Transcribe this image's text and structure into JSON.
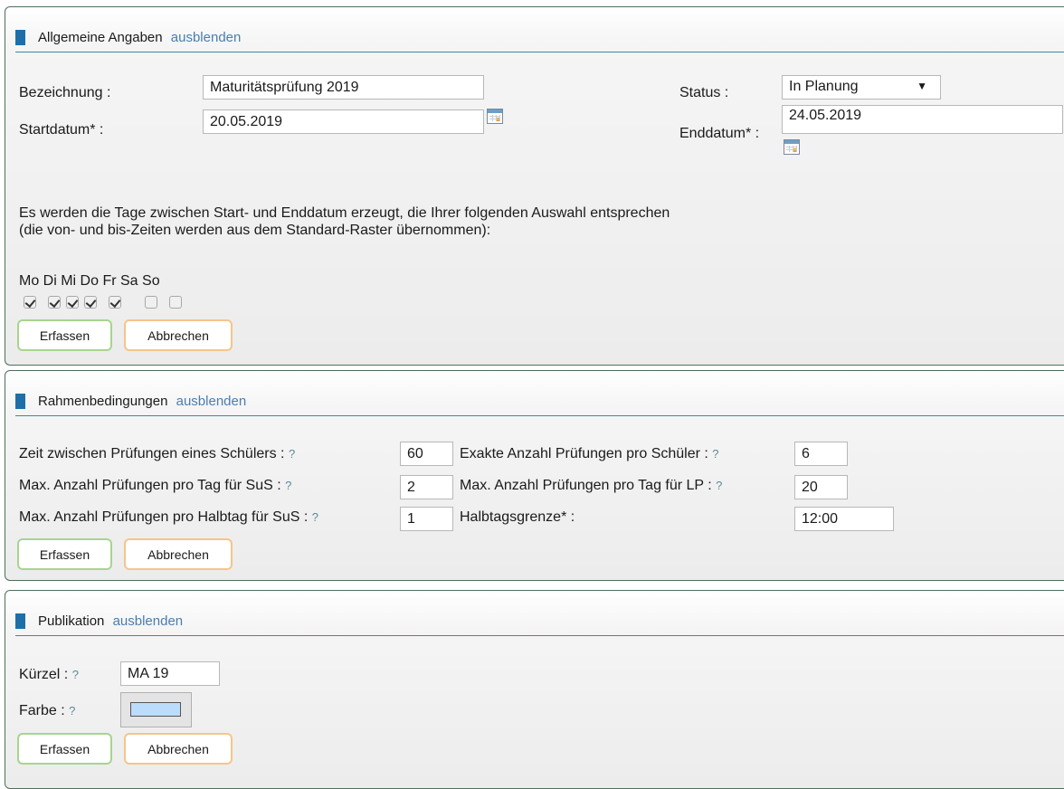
{
  "panel_general": {
    "title": "Allgemeine Angaben",
    "toggle": "ausblenden",
    "label_bezeichnung": "Bezeichnung :",
    "value_bezeichnung": "Maturitätsprüfung 2019",
    "label_startdatum": "Startdatum* :",
    "value_startdatum": "20.05.2019",
    "label_status": "Status :",
    "value_status": "In Planung",
    "label_enddatum": "Enddatum* :",
    "value_enddatum": "24.05.2019",
    "info_text": "Es werden die Tage zwischen Start- und Enddatum erzeugt, die Ihrer folgenden Auswahl entsprechen (die von- und bis-Zeiten werden aus dem Standard-Raster übernommen):",
    "days_header": "Mo Di Mi Do Fr Sa So",
    "days": [
      {
        "name": "Mo",
        "checked": true
      },
      {
        "name": "Di",
        "checked": true
      },
      {
        "name": "Mi",
        "checked": true
      },
      {
        "name": "Do",
        "checked": true
      },
      {
        "name": "Fr",
        "checked": true
      },
      {
        "name": "Sa",
        "checked": false
      },
      {
        "name": "So",
        "checked": false
      }
    ],
    "submit": "Erfassen",
    "cancel": "Abbrechen"
  },
  "panel_rahmen": {
    "title": "Rahmenbedingungen",
    "toggle": "ausblenden",
    "help": "?",
    "label_zeit": "Zeit zwischen Prüfungen eines Schülers :",
    "value_zeit": "60",
    "label_exakt": "Exakte Anzahl Prüfungen pro Schüler :",
    "value_exakt": "6",
    "label_max_tag_sus": "Max. Anzahl Prüfungen pro Tag für SuS :",
    "value_max_tag_sus": "2",
    "label_max_tag_lp": "Max. Anzahl Prüfungen pro Tag für LP :",
    "value_max_tag_lp": "20",
    "label_max_halbtag_sus": "Max. Anzahl Prüfungen pro Halbtag für SuS :",
    "value_max_halbtag_sus": "1",
    "label_halbtagsgrenze": "Halbtagsgrenze* :",
    "value_halbtagsgrenze": "12:00",
    "submit": "Erfassen",
    "cancel": "Abbrechen"
  },
  "panel_publikation": {
    "title": "Publikation",
    "toggle": "ausblenden",
    "help": "?",
    "label_kuerzel": "Kürzel :",
    "value_kuerzel": "MA 19",
    "label_farbe": "Farbe :",
    "color": "#bcdcfb",
    "submit": "Erfassen",
    "cancel": "Abbrechen"
  },
  "icons": {
    "calendar": "calendar-icon",
    "dropdown": "dropdown-arrow-icon"
  }
}
